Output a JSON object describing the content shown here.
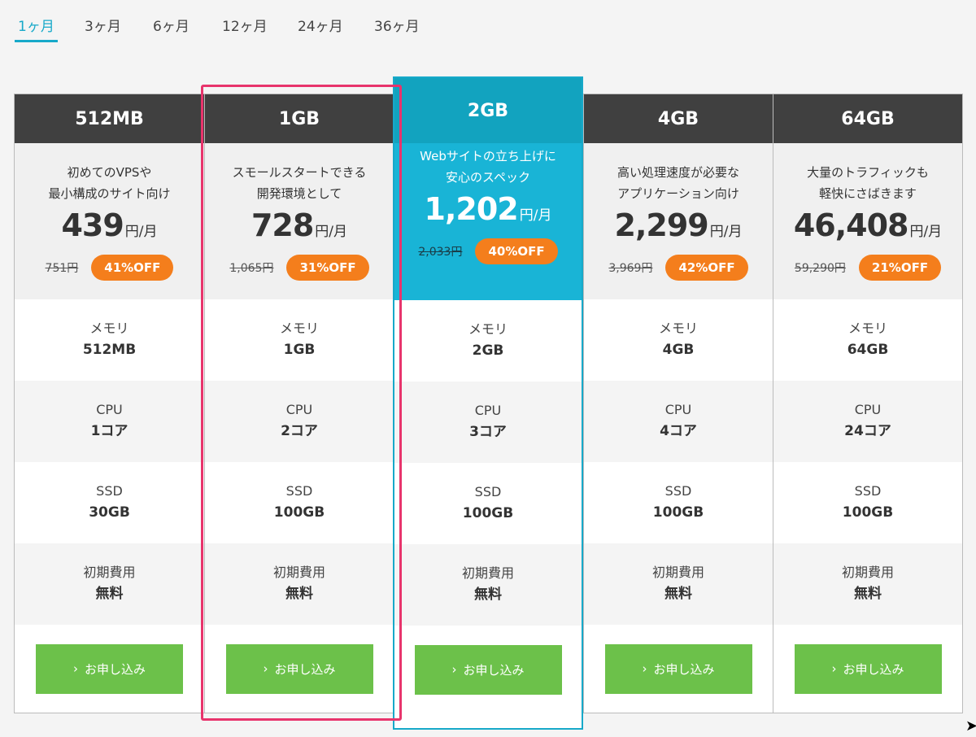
{
  "tabs": [
    {
      "label": "1ヶ月",
      "active": true
    },
    {
      "label": "3ヶ月",
      "active": false
    },
    {
      "label": "6ヶ月",
      "active": false
    },
    {
      "label": "12ヶ月",
      "active": false
    },
    {
      "label": "24ヶ月",
      "active": false
    },
    {
      "label": "36ヶ月",
      "active": false
    }
  ],
  "colors": {
    "accent": "#17a9c9",
    "header_dark": "#404040",
    "featured_header": "#12a3bf",
    "featured_intro": "#19b4d6",
    "discount_badge": "#f47e1c",
    "cta_green": "#6cc14a",
    "highlight_pink": "#e8346c"
  },
  "spec_labels": {
    "memory": "メモリ",
    "cpu": "CPU",
    "ssd": "SSD",
    "setup_fee": "初期費用"
  },
  "cta_label": "お申し込み",
  "cta_icon": "chevron-right-icon",
  "plans": [
    {
      "name": "512MB",
      "desc1": "初めてのVPSや",
      "desc2": "最小構成のサイト向け",
      "price": "439",
      "unit": "円/月",
      "original": "751円",
      "discount": "41%OFF",
      "memory": "512MB",
      "cpu": "1コア",
      "ssd": "30GB",
      "setup_fee": "無料"
    },
    {
      "name": "1GB",
      "desc1": "スモールスタートできる",
      "desc2": "開発環境として",
      "price": "728",
      "unit": "円/月",
      "original": "1,065円",
      "discount": "31%OFF",
      "memory": "1GB",
      "cpu": "2コア",
      "ssd": "100GB",
      "setup_fee": "無料"
    },
    {
      "name": "2GB",
      "featured": true,
      "desc1": "Webサイトの立ち上げに",
      "desc2": "安心のスペック",
      "price": "1,202",
      "unit": "円/月",
      "original": "2,033円",
      "discount": "40%OFF",
      "memory": "2GB",
      "cpu": "3コア",
      "ssd": "100GB",
      "setup_fee": "無料"
    },
    {
      "name": "4GB",
      "desc1": "高い処理速度が必要な",
      "desc2": "アプリケーション向け",
      "price": "2,299",
      "unit": "円/月",
      "original": "3,969円",
      "discount": "42%OFF",
      "memory": "4GB",
      "cpu": "4コア",
      "ssd": "100GB",
      "setup_fee": "無料"
    },
    {
      "name": "64GB",
      "desc1": "大量のトラフィックも",
      "desc2": "軽快にさばきます",
      "price": "46,408",
      "unit": "円/月",
      "original": "59,290円",
      "discount": "21%OFF",
      "memory": "64GB",
      "cpu": "24コア",
      "ssd": "100GB",
      "setup_fee": "無料"
    }
  ]
}
